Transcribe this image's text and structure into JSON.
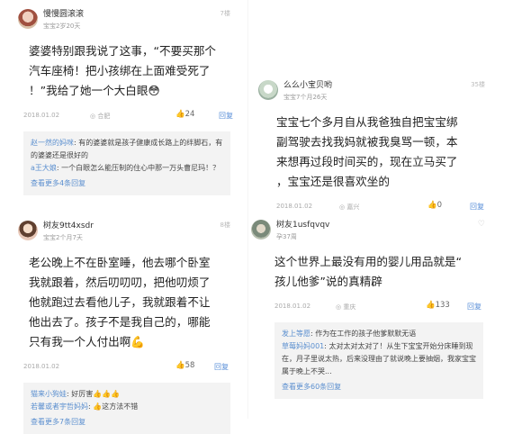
{
  "posts": [
    {
      "username": "慢慢圆滚滚",
      "meta": "宝宝2岁20天",
      "floor": "7楼",
      "body": [
        "婆婆特别跟我说了这事，“不要买那个",
        "汽车座椅！把小孩绑在上面难受死了",
        "！”我给了她一个大白眼😳"
      ],
      "date": "2018.01.02",
      "location": "合肥",
      "likes": "24",
      "reply_label": "回复",
      "replies": [
        {
          "name": "赵一然的妈咪",
          "text": ": 有的婆婆就是孩子健康成长路上的绊脚石，有的婆婆还是很好的"
        },
        {
          "name": "a王大娘",
          "text": ": 一个白眼怎么能压制的住心中那一万头曹尼玛！？"
        }
      ],
      "more_replies": "查看更多4条回复"
    },
    {
      "username": "么么小宝贝哟",
      "meta": "宝宝7个月26天",
      "floor": "35楼",
      "body": [
        "宝宝七个多月自从我爸独自把宝宝绑",
        "副驾驶去找我妈就被我臭骂一顿，本",
        "来想再过段时间买的，现在立马买了",
        "，宝宝还是很喜欢坐的"
      ],
      "date": "2018.01.02",
      "location": "嘉兴",
      "likes": "0",
      "reply_label": "回复"
    },
    {
      "username": "树友9tt4xsdr",
      "meta": "宝宝2个月7天",
      "floor": "8楼",
      "body": [
        "老公晚上不在卧室睡，他去哪个卧室",
        "我就跟着，然后叨叨叨，把他叨烦了",
        "他就跑过去看他儿子，我就跟着不让",
        "他出去了。孩子不是我自己的，哪能",
        "只有我一个人付出啊💪"
      ],
      "date": "2018.01.02",
      "location": "",
      "likes": "58",
      "reply_label": "回复",
      "replies": [
        {
          "name": "猫来小狗娃",
          "text": ": 好厉害👍👍👍"
        },
        {
          "name": "若馨或者宇哲妈妈",
          "text": ": 👍这方法不错"
        }
      ],
      "more_replies": "查看更多7条回复"
    },
    {
      "username": "树友1usfqvqv",
      "meta": "孕37周",
      "floor": "",
      "body": [
        "这个世界上最没有用的婴儿用品就是“",
        "孩儿他爹”说的真精辟"
      ],
      "date": "2018.01.02",
      "location": "重庆",
      "likes": "133",
      "reply_label": "回复",
      "replies": [
        {
          "name": "发上等愿",
          "text": ": 作为在工作的孩子他爹默默无语"
        },
        {
          "name": "草莓妈妈001",
          "text": ": 太对太对太对了！从生下宝宝开始分床睡到现在，月子里说太热，后来没理由了就说晚上要抽烟，我家宝宝属于晚上不哭..."
        }
      ],
      "more_replies": "查看更多60条回复"
    }
  ],
  "colors": {
    "link": "#5b8fcf",
    "reply_bg": "#f3f3f3",
    "text": "#222222",
    "muted": "#aaaaaa"
  }
}
